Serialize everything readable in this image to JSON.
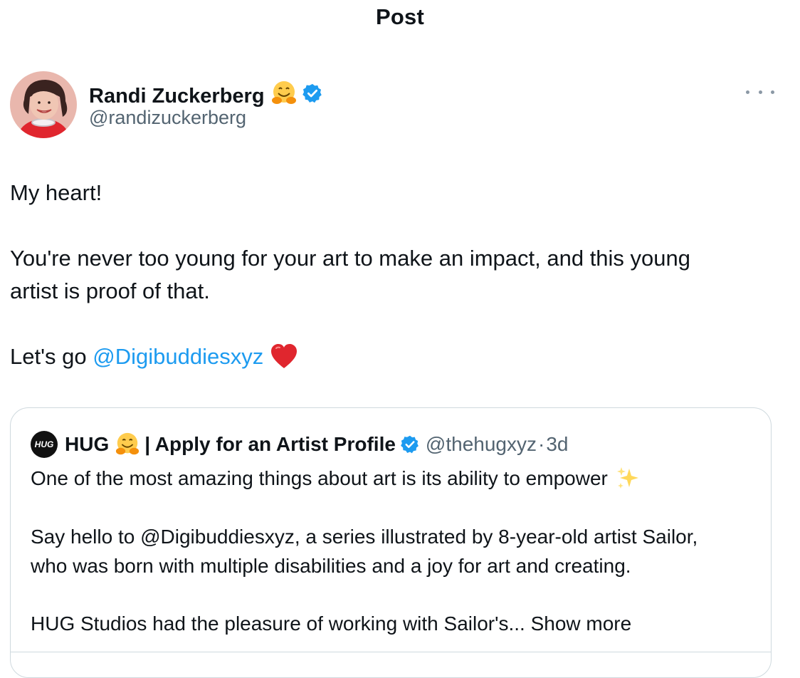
{
  "header": {
    "title": "Post"
  },
  "author": {
    "name": "Randi Zuckerberg",
    "handle": "@randizuckerberg",
    "name_emoji": "hugging-face",
    "verified": true
  },
  "post": {
    "line1": "My heart!",
    "line2a": "You're never too young for your art to make an impact, and this young",
    "line2b": "artist is proof of that.",
    "line3_prefix": "Let's go ",
    "line3_mention": "@Digibuddiesxyz",
    "line3_emoji": "red-heart"
  },
  "quote": {
    "logo_text": "HUG",
    "name_part1": "HUG",
    "name_part2": "| Apply for an Artist Profile",
    "handle": "@thehugxyz",
    "separator": "·",
    "time": "3d",
    "line1": "One of the most amazing things about art is its ability to empower",
    "line2a": "Say hello to @Digibuddiesxyz, a series illustrated by 8-year-old artist Sailor,",
    "line2b": "who was born with multiple disabilities and a joy for art and creating.",
    "line3_prefix": "HUG Studios had the pleasure of working with Sailor's...",
    "show_more": "Show more"
  },
  "colors": {
    "accent": "#1d9bf0",
    "text": "#0f1419",
    "secondary": "#536471",
    "border": "#cfd9de"
  }
}
